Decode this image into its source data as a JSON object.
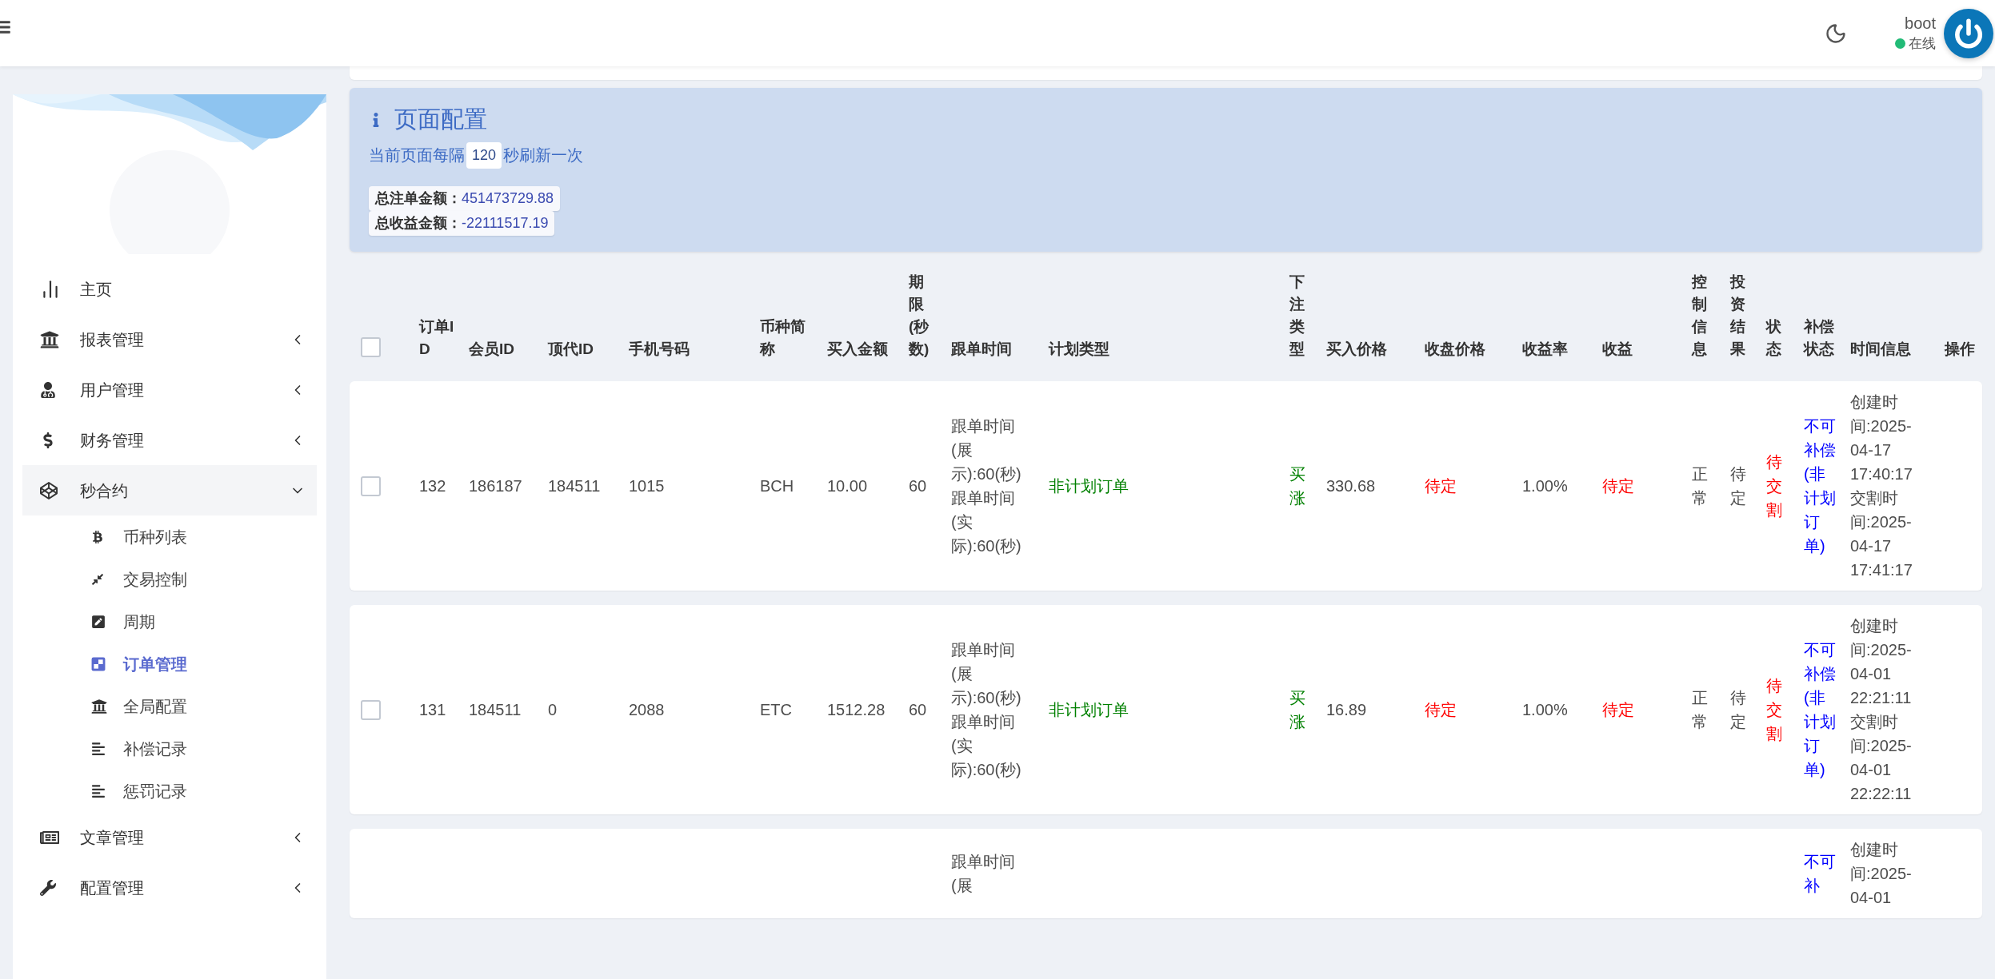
{
  "header": {
    "user": {
      "name": "boot",
      "status": "在线",
      "online": true
    }
  },
  "sidebar": {
    "items": [
      {
        "label": "主页",
        "kind": "link"
      },
      {
        "label": "报表管理",
        "kind": "group",
        "expanded": false
      },
      {
        "label": "用户管理",
        "kind": "group",
        "expanded": false
      },
      {
        "label": "财务管理",
        "kind": "group",
        "expanded": false
      },
      {
        "label": "秒合约",
        "kind": "group",
        "expanded": true,
        "children": [
          {
            "label": "币种列表",
            "selected": false
          },
          {
            "label": "交易控制",
            "selected": false
          },
          {
            "label": "周期",
            "selected": false
          },
          {
            "label": "订单管理",
            "selected": true
          },
          {
            "label": "全局配置",
            "selected": false
          },
          {
            "label": "补偿记录",
            "selected": false
          },
          {
            "label": "惩罚记录",
            "selected": false
          }
        ]
      },
      {
        "label": "文章管理",
        "kind": "group",
        "expanded": false
      },
      {
        "label": "配置管理",
        "kind": "group",
        "expanded": false
      }
    ]
  },
  "page_config": {
    "title": "页面配置",
    "refresh_prefix": "当前页面每隔",
    "refresh_seconds": "120",
    "refresh_suffix": "秒刷新一次",
    "stats": [
      {
        "label": "总注单金额：",
        "value": "451473729.88"
      },
      {
        "label": "总收益金额：",
        "value": "-22111517.19"
      }
    ]
  },
  "table": {
    "select_all_checked": false,
    "columns": [
      "订单ID",
      "会员ID",
      "顶代ID",
      "手机号码",
      "币种简称",
      "买入金额",
      "期限(秒数)",
      "跟单时间",
      "计划类型",
      "下注类型",
      "买入价格",
      "收盘价格",
      "收益率",
      "收益",
      "控制信息",
      "投资结果",
      "状态",
      "补偿状态",
      "时间信息",
      "操作"
    ],
    "rows": [
      {
        "checked": false,
        "order_id": "132",
        "member_id": "186187",
        "top_agent_id": "184511",
        "phone": "1015",
        "coin": "BCH",
        "amount": "10.00",
        "period": "60",
        "follow_times": [
          "跟单时间(展示):60(秒)",
          "跟单时间(实际):60(秒)"
        ],
        "plan_type": "非计划订单",
        "bet_type": "买涨",
        "buy_price": "330.68",
        "close_price": "待定",
        "yield_rate": "1.00%",
        "profit": "待定",
        "control": "正常",
        "result": "待定",
        "status": "待交割",
        "compensation": "不可补偿(非计划订单)",
        "times": [
          "创建时间:2025-04-17 17:40:17",
          "交割时间:2025-04-17 17:41:17"
        ]
      },
      {
        "checked": false,
        "order_id": "131",
        "member_id": "184511",
        "top_agent_id": "0",
        "phone": "2088",
        "coin": "ETC",
        "amount": "1512.28",
        "period": "60",
        "follow_times": [
          "跟单时间(展示):60(秒)",
          "跟单时间(实际):60(秒)"
        ],
        "plan_type": "非计划订单",
        "bet_type": "买涨",
        "buy_price": "16.89",
        "close_price": "待定",
        "yield_rate": "1.00%",
        "profit": "待定",
        "control": "正常",
        "result": "待定",
        "status": "待交割",
        "compensation": "不可补偿(非计划订单)",
        "times": [
          "创建时间:2025-04-01 22:21:11",
          "交割时间:2025-04-01 22:22:11"
        ]
      },
      {
        "follow_times": [
          "跟单时间(展"
        ],
        "compensation": "不可补",
        "times": [
          "创建时间:2025-04-01"
        ]
      }
    ]
  }
}
